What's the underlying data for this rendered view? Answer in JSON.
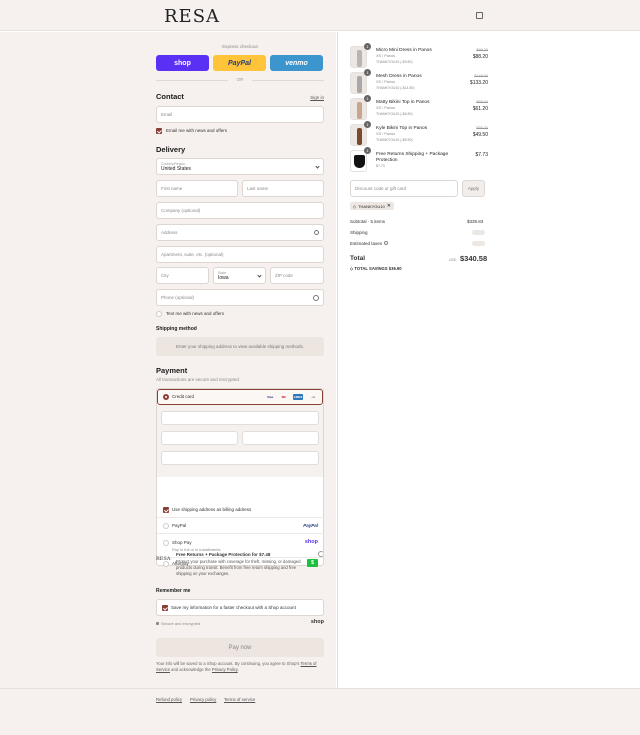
{
  "header": {
    "logo": "RESA"
  },
  "express": {
    "label": "Express checkout",
    "shop": "shop",
    "paypal": "PayPal",
    "venmo": "venmo",
    "or": "OR"
  },
  "contact": {
    "title": "Contact",
    "sign_in": "Sign in",
    "email_placeholder": "Email",
    "email_news": "Email me with news and offers"
  },
  "delivery": {
    "title": "Delivery",
    "country_label": "Country/Region",
    "country_value": "United States",
    "first_name": "First name",
    "last_name": "Last name",
    "company": "Company (optional)",
    "address": "Address",
    "apartment": "Apartment, suite, etc. (optional)",
    "city": "City",
    "state_label": "State",
    "state_value": "Iowa",
    "zip": "ZIP code",
    "phone": "Phone (optional)",
    "text_news": "Text me with news and offers"
  },
  "shipping": {
    "title": "Shipping method",
    "message": "Enter your shipping address to view available shipping methods."
  },
  "payment": {
    "title": "Payment",
    "subtitle": "All transactions are secure and encrypted.",
    "credit_card": "Credit card",
    "card_brands": [
      "Visa",
      "MC",
      "AMEX",
      "+4"
    ],
    "billing_same": "Use shipping address as billing address",
    "paypal": "PayPal",
    "paypal_logo": "PayPal",
    "shop_pay": "Shop Pay",
    "shop_pay_sub": "Pay in full or in installments",
    "shop_logo": "shop",
    "afterpay": "Afterpay",
    "afterpay_logo": "$"
  },
  "protection": {
    "logo": "RESA",
    "title": "Free Returns + Package Protection for $7.48",
    "desc": "Protect your purchase with coverage for theft, missing, or damaged products during transit. Benefit from free return shipping and free shipping on your exchanges."
  },
  "remember": {
    "title": "Remember me",
    "save_info": "Save my information for a faster checkout with a Shop account",
    "secure": "Secure and encrypted",
    "shop_logo": "shop"
  },
  "pay_now": "Pay now",
  "legal": {
    "line1": "Your info will be saved to a Shop account. By continuing, you agree to Shop's",
    "tos": "Terms of Service",
    "and": "and acknowledge the",
    "privacy": "Privacy Policy",
    "end": "."
  },
  "footer": {
    "links": [
      "Refund policy",
      "Privacy policy",
      "Terms of service"
    ]
  },
  "summary": {
    "items": [
      {
        "qty": "1",
        "name": "Micro Mini Dress in Panos",
        "variant": "XS / Panos",
        "discount": "THANKYOU10 (-$9.80)",
        "old": "$98.00",
        "new": "$88.20",
        "color": "#d8d4d2"
      },
      {
        "qty": "1",
        "name": "Mesh Dress in Panos",
        "variant": "XS / Panos",
        "discount": "THANKYOU10 (-$14.80)",
        "old": "$148.00",
        "new": "$133.20",
        "color": "#c9c7c8"
      },
      {
        "qty": "1",
        "name": "Matty Bikini Top in Panos",
        "variant": "XS / Panos",
        "discount": "THANKYOU10 (-$6.80)",
        "old": "$68.00",
        "new": "$61.20",
        "color": "#d2b8a8"
      },
      {
        "qty": "1",
        "name": "Kyle Bikini Top in Panos",
        "variant": "XS / Panos",
        "discount": "THANKYOU10 (-$5.50)",
        "old": "$55.00",
        "new": "$49.50",
        "color": "#8a5a3c"
      }
    ],
    "protection_item": {
      "qty": "1",
      "name": "Free Returns Shipping + Package",
      "name2": "Protection",
      "sub": "$7.73",
      "price": "$7.73"
    },
    "discount_placeholder": "Discount code or gift card",
    "apply": "Apply",
    "code_tag": "THANKYOU10",
    "subtotal_label": "Subtotal · 5 items",
    "subtotal_value": "$339.83",
    "shipping_label": "Shipping",
    "taxes_label": "Estimated taxes",
    "total_label": "Total",
    "currency": "USD",
    "total_value": "$340.58",
    "savings_label": "TOTAL SAVINGS",
    "savings_value": "$36.90"
  }
}
